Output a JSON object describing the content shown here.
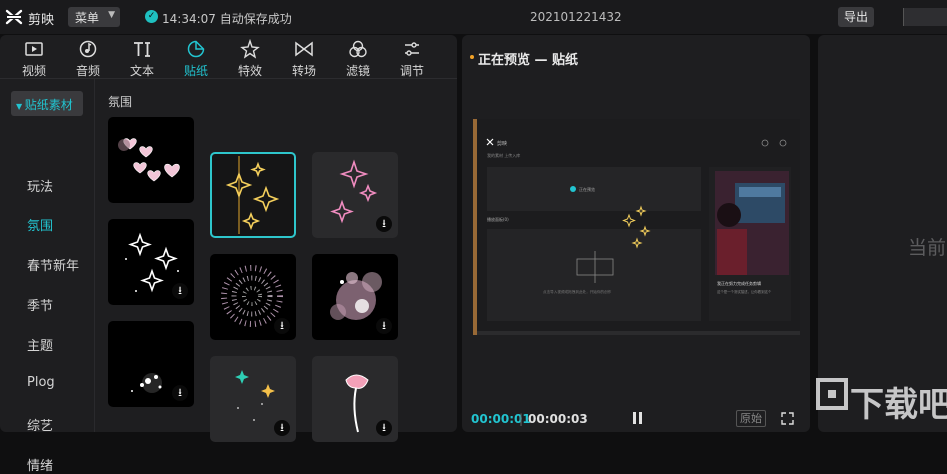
{
  "app": {
    "name": "剪映",
    "menu_label": "菜单",
    "save_status": "14:34:07 自动保存成功",
    "project_title": "202101221432",
    "export_label": "导出"
  },
  "tabs": [
    {
      "label": "视频",
      "icon": "video-icon"
    },
    {
      "label": "音频",
      "icon": "audio-icon"
    },
    {
      "label": "文本",
      "icon": "text-icon"
    },
    {
      "label": "贴纸",
      "icon": "sticker-icon",
      "active": true
    },
    {
      "label": "特效",
      "icon": "effects-icon"
    },
    {
      "label": "转场",
      "icon": "transition-icon"
    },
    {
      "label": "滤镜",
      "icon": "filter-icon"
    },
    {
      "label": "调节",
      "icon": "adjust-icon"
    }
  ],
  "categories": {
    "header": "贴纸素材",
    "items": [
      "玩法",
      "氛围",
      "春节新年",
      "季节",
      "主题",
      "Plog",
      "综艺",
      "情绪"
    ],
    "active": "氛围"
  },
  "section_title": "氛围",
  "preview": {
    "title": "正在预览 — 贴纸",
    "current_time": "00:00:01",
    "total_time": "00:00:03",
    "separator": "|",
    "original_label": "原始",
    "inner": {
      "app_name": "剪映",
      "breadcrumb": "我的素材  上传入库",
      "preview_label": "正在预览",
      "props_label": "播放面板(0)",
      "caption1": "我正在努力完成任务剪辑",
      "caption2": "这个是一个测试描述，让你看到这个",
      "hint": "点击导入视频或拖拽到此处，开始你的创作"
    }
  },
  "props": {
    "placeholder": "当前线"
  },
  "watermark": "下载吧",
  "colors": {
    "accent": "#22c4d0",
    "bg": "#1e1e20"
  }
}
